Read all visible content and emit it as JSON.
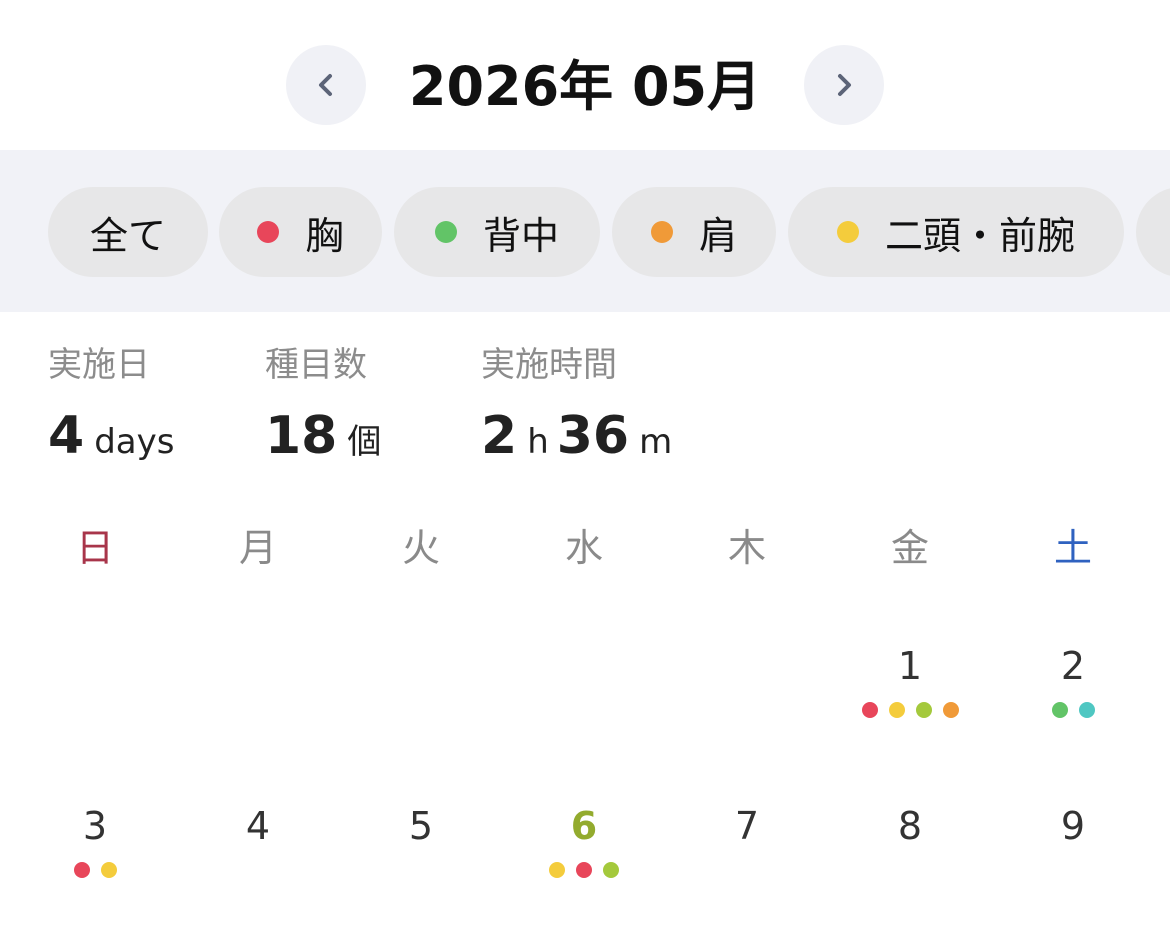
{
  "header": {
    "title": "2026年 05月",
    "prev_icon": "chevron-left-icon",
    "next_icon": "chevron-right-icon"
  },
  "filters": [
    {
      "label": "全て",
      "active": true,
      "color": null
    },
    {
      "label": "胸",
      "active": false,
      "color": "#e8465a"
    },
    {
      "label": "背中",
      "active": false,
      "color": "#62c467"
    },
    {
      "label": "肩",
      "active": false,
      "color": "#f09a38"
    },
    {
      "label": "二頭・前腕",
      "active": false,
      "color": "#f4cc3c"
    },
    {
      "label": "",
      "active": false,
      "color": null
    }
  ],
  "stats": [
    {
      "label": "実施日",
      "parts": [
        {
          "num": "4",
          "unit": "days"
        }
      ]
    },
    {
      "label": "種目数",
      "parts": [
        {
          "num": "18",
          "unit": "個"
        }
      ]
    },
    {
      "label": "実施時間",
      "parts": [
        {
          "num": "2",
          "unit": "h"
        },
        {
          "num": "36",
          "unit": "m"
        }
      ]
    }
  ],
  "weekdays": [
    "日",
    "月",
    "火",
    "水",
    "木",
    "金",
    "土"
  ],
  "weeks": [
    [
      null,
      null,
      null,
      null,
      null,
      {
        "day": "1",
        "dots": [
          "#e8465a",
          "#f4cc3c",
          "#a4c93c",
          "#f09a38"
        ]
      },
      {
        "day": "2",
        "dots": [
          "#62c467",
          "#4fc7c2"
        ]
      }
    ],
    [
      {
        "day": "3",
        "dots": [
          "#e8465a",
          "#f4cc3c"
        ]
      },
      {
        "day": "4",
        "dots": []
      },
      {
        "day": "5",
        "dots": []
      },
      {
        "day": "6",
        "today": true,
        "dots": [
          "#f4cc3c",
          "#e8465a",
          "#a4c93c"
        ]
      },
      {
        "day": "7",
        "dots": []
      },
      {
        "day": "8",
        "dots": []
      },
      {
        "day": "9",
        "dots": []
      }
    ]
  ]
}
